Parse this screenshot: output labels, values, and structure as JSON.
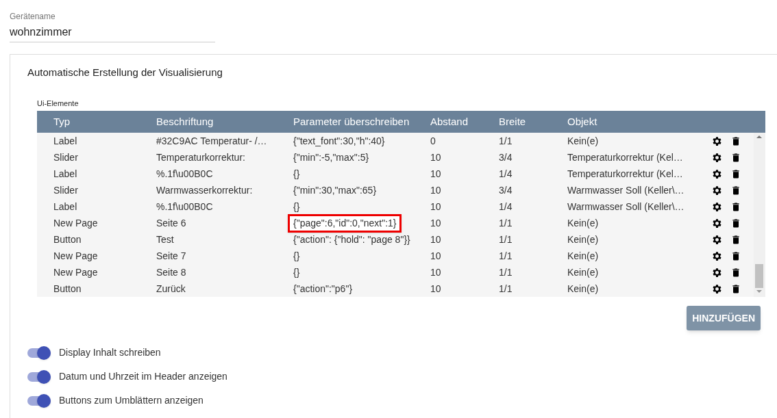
{
  "device_name": {
    "label": "Gerätename",
    "value": "wohnzimmer"
  },
  "panel": {
    "title": "Automatische Erstellung der Visualisierung",
    "table": {
      "label": "Ui-Elemente",
      "columns": [
        "Typ",
        "Beschriftung",
        "Parameter überschreiben",
        "Abstand",
        "Breite",
        "Objekt"
      ],
      "rows": [
        {
          "cells": [
            "Label",
            "#32C9AC Temperatur- /…",
            "{\"text_font\":30,\"h\":40}",
            "0",
            "1/1",
            "Kein(e)"
          ],
          "highlighted": false
        },
        {
          "cells": [
            "Slider",
            "Temperaturkorrektur:",
            "{\"min\":-5,\"max\":5}",
            "10",
            "3/4",
            "Temperaturkorrektur (Kel…"
          ],
          "highlighted": false
        },
        {
          "cells": [
            "Label",
            "%.1f\\u00B0C",
            "{}",
            "10",
            "1/4",
            "Temperaturkorrektur (Kel…"
          ],
          "highlighted": false
        },
        {
          "cells": [
            "Slider",
            "Warmwasserkorrektur:",
            "{\"min\":30,\"max\":65}",
            "10",
            "3/4",
            "Warmwasser Soll (Keller\\…"
          ],
          "highlighted": false
        },
        {
          "cells": [
            "Label",
            "%.1f\\u00B0C",
            "{}",
            "10",
            "1/4",
            "Warmwasser Soll (Keller\\…"
          ],
          "highlighted": false
        },
        {
          "cells": [
            "New Page",
            "Seite 6",
            "{\"page\":6,\"id\":0,\"next\":1}",
            "10",
            "1/1",
            "Kein(e)"
          ],
          "highlighted": true
        },
        {
          "cells": [
            "Button",
            "Test",
            "{\"action\": {\"hold\": \"page 8\"}}",
            "10",
            "1/1",
            "Kein(e)"
          ],
          "highlighted": false
        },
        {
          "cells": [
            "New Page",
            "Seite 7",
            "{}",
            "10",
            "1/1",
            "Kein(e)"
          ],
          "highlighted": false
        },
        {
          "cells": [
            "New Page",
            "Seite 8",
            "{}",
            "10",
            "1/1",
            "Kein(e)"
          ],
          "highlighted": false
        },
        {
          "cells": [
            "Button",
            "Zurück",
            "{\"action\":\"p6\"}",
            "10",
            "1/1",
            "Kein(e)"
          ],
          "highlighted": false
        }
      ]
    },
    "add_button": "HINZUFÜGEN",
    "toggles": [
      {
        "label": "Display Inhalt schreiben",
        "on": true
      },
      {
        "label": "Datum und Uhrzeit im Header anzeigen",
        "on": true
      },
      {
        "label": "Buttons zum Umblättern anzeigen",
        "on": true
      }
    ]
  }
}
